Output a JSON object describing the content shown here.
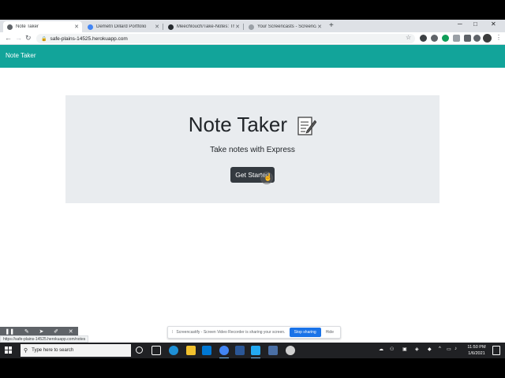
{
  "browser": {
    "tabs": [
      {
        "title": "Note Taker",
        "active": true,
        "favicon_color": "#5f6368"
      },
      {
        "title": "Demetri Dillard Portfolio",
        "active": false,
        "favicon_color": "#4285f4"
      },
      {
        "title": "Meechlouch/Take-Notes: This ap...",
        "active": false,
        "favicon_color": "#24292e"
      },
      {
        "title": "Your Screencasts - Screencastify",
        "active": false,
        "favicon_color": "#9aa0a6"
      }
    ],
    "url": "safe-plains-14525.herokuapp.com",
    "status_url": "https://safe-plains-14525.herokuapp.com/notes"
  },
  "page": {
    "brand": "Note Taker",
    "title": "Note Taker",
    "subtitle": "Take notes with Express",
    "cta_label": "Get Started"
  },
  "screencastify": {
    "message": "Screencastify - Screen Video Recorder is sharing your screen.",
    "stop_label": "Stop sharing",
    "hide_label": "Hide"
  },
  "taskbar": {
    "search_placeholder": "Type here to search",
    "time": "11:50 PM",
    "date": "1/6/2021"
  },
  "colors": {
    "navbar": "#12a49a",
    "jumbotron": "#e9ecef",
    "button": "#343a40",
    "stop_button": "#1a73e8"
  }
}
